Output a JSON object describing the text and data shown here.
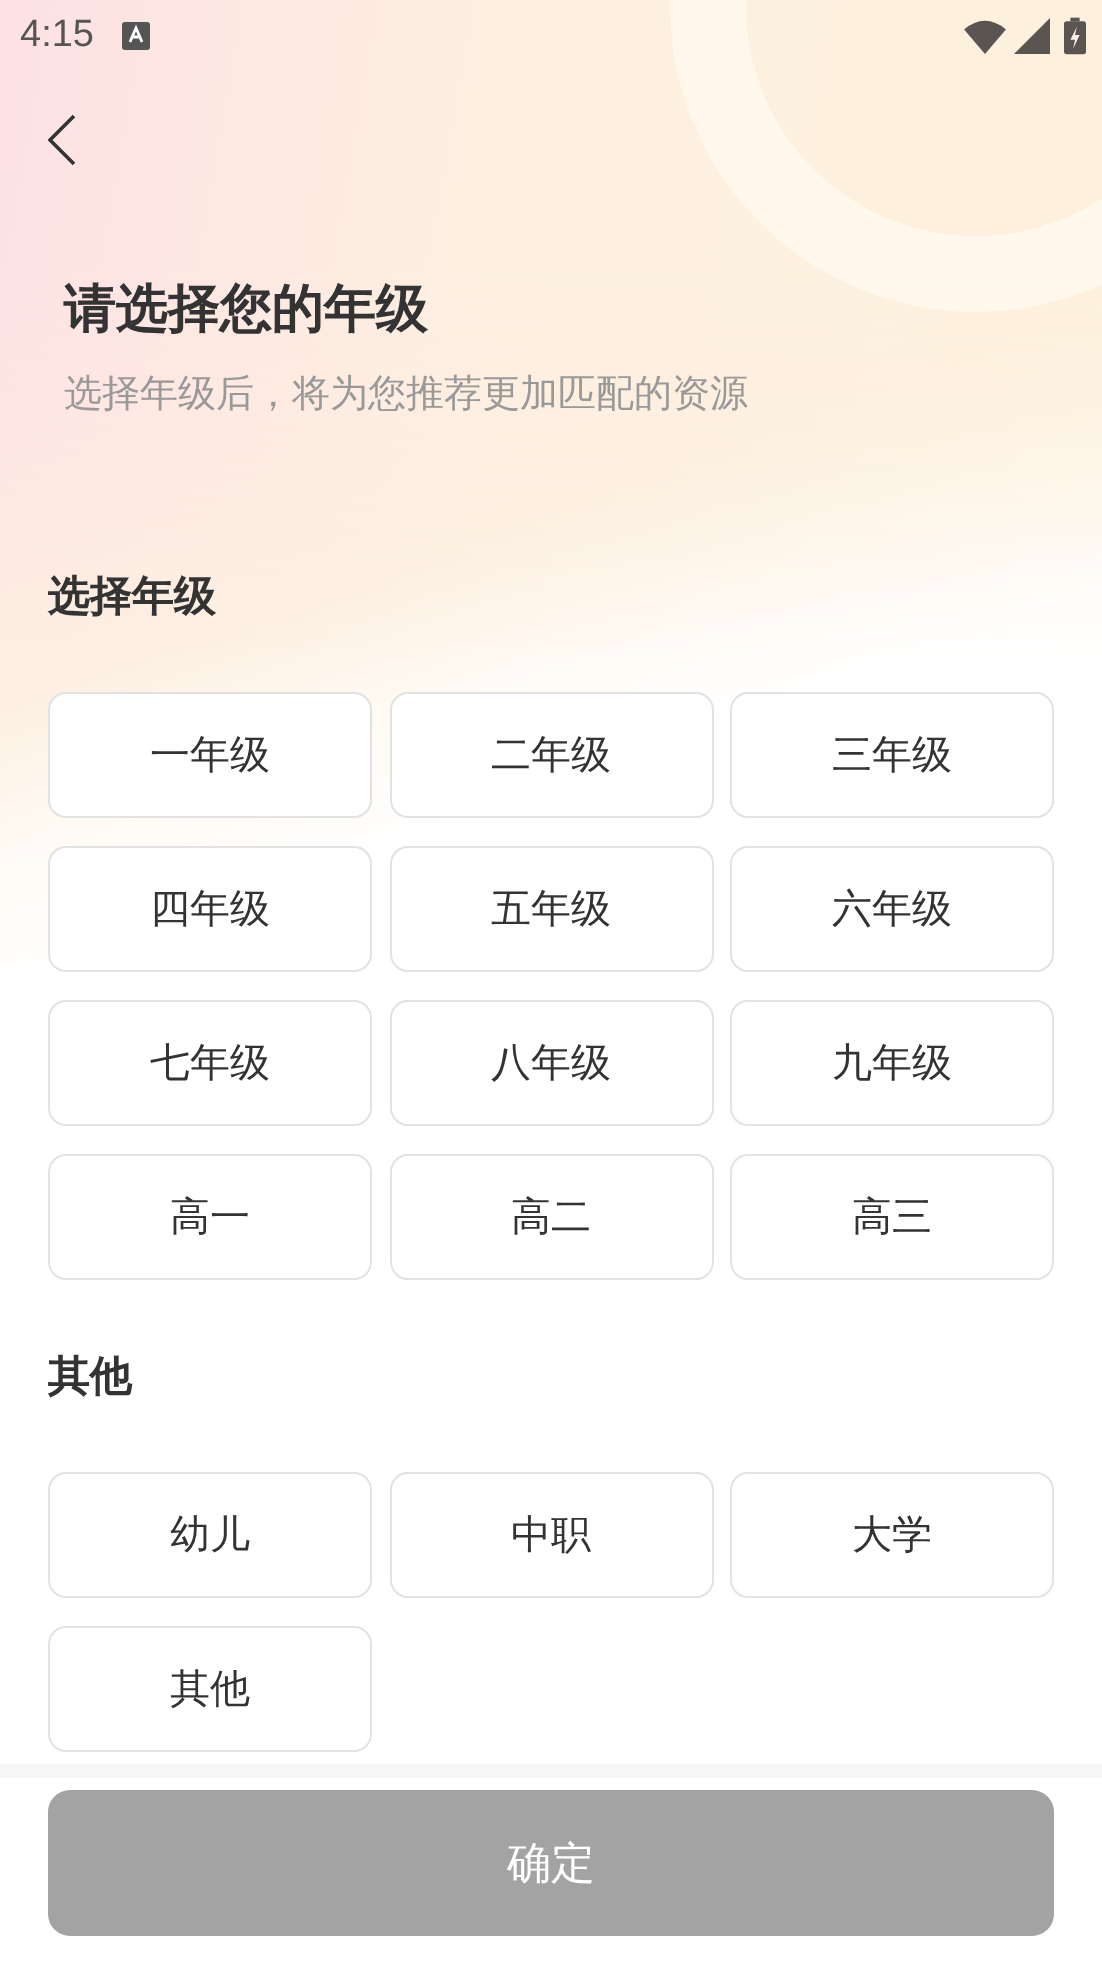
{
  "status_bar": {
    "time": "4:15"
  },
  "header": {
    "title": "请选择您的年级",
    "subtitle": "选择年级后，将为您推荐更加匹配的资源"
  },
  "sections": [
    {
      "heading": "选择年级",
      "options": [
        {
          "label": "一年级",
          "selected": false
        },
        {
          "label": "二年级",
          "selected": false
        },
        {
          "label": "三年级",
          "selected": false
        },
        {
          "label": "四年级",
          "selected": false
        },
        {
          "label": "五年级",
          "selected": false
        },
        {
          "label": "六年级",
          "selected": false
        },
        {
          "label": "七年级",
          "selected": false
        },
        {
          "label": "八年级",
          "selected": false
        },
        {
          "label": "九年级",
          "selected": false
        },
        {
          "label": "高一",
          "selected": false
        },
        {
          "label": "高二",
          "selected": false
        },
        {
          "label": "高三",
          "selected": false
        }
      ]
    },
    {
      "heading": "其他",
      "options": [
        {
          "label": "幼儿",
          "selected": false
        },
        {
          "label": "中职",
          "selected": false
        },
        {
          "label": "大学",
          "selected": false
        },
        {
          "label": "其他",
          "selected": false
        }
      ]
    }
  ],
  "confirm_button": {
    "label": "确定",
    "disabled": true
  }
}
